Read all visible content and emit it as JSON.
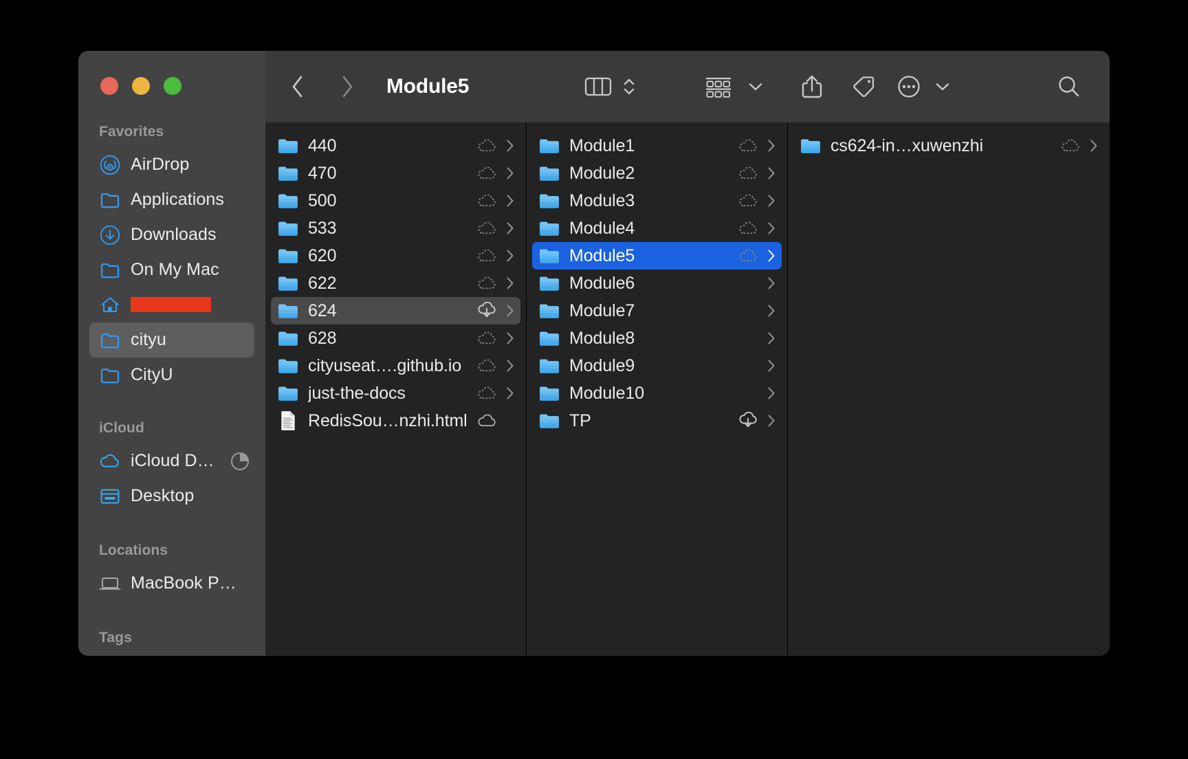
{
  "window": {
    "traffic_lights": [
      "close",
      "minimize",
      "maximize"
    ],
    "colors": {
      "sidebar_bg": "#434343",
      "toolbar_bg": "#3a3a3a",
      "content_bg": "#232323",
      "accent_blue": "#1a62e0",
      "folder_blue": "#54b4ef",
      "icon_blue": "#2196f3",
      "redaction_red": "#e8371b",
      "selected_gray": "#4a4a4a"
    }
  },
  "toolbar": {
    "back_label": "Back",
    "forward_label": "Forward",
    "title": "Module5",
    "view_label": "Column View",
    "view_chevron_label": "View Options",
    "arrange_label": "Group Items",
    "arrange_chevron_label": "Group Options",
    "share_label": "Share",
    "tag_label": "Tags",
    "more_label": "More",
    "more_chevron_label": "More Options",
    "search_label": "Search"
  },
  "sidebar": {
    "sections": [
      {
        "id": "favorites",
        "header": "Favorites"
      },
      {
        "id": "icloud",
        "header": "iCloud"
      },
      {
        "id": "locations",
        "header": "Locations"
      },
      {
        "id": "tags",
        "header": "Tags"
      }
    ],
    "favorites": [
      {
        "label": "AirDrop",
        "icon": "airdrop-icon",
        "selected": false,
        "redacted": false
      },
      {
        "label": "Applications",
        "icon": "folder-icon",
        "selected": false,
        "redacted": false
      },
      {
        "label": "Downloads",
        "icon": "downloads-icon",
        "selected": false,
        "redacted": false
      },
      {
        "label": "On My Mac",
        "icon": "folder-icon",
        "selected": false,
        "redacted": false
      },
      {
        "label": "",
        "icon": "home-icon",
        "selected": false,
        "redacted": true
      },
      {
        "label": "cityu",
        "icon": "folder-icon",
        "selected": true,
        "redacted": false
      },
      {
        "label": "CityU",
        "icon": "folder-icon",
        "selected": false,
        "redacted": false
      }
    ],
    "icloud": [
      {
        "label": "iCloud D…",
        "icon": "icloud-icon",
        "selected": false,
        "progress": true
      },
      {
        "label": "Desktop",
        "icon": "desktop-icon",
        "selected": false,
        "progress": false
      }
    ],
    "locations": [
      {
        "label": "MacBook P…",
        "icon": "laptop-icon",
        "selected": false
      }
    ],
    "tags_header_partial": "Tags"
  },
  "columns": [
    {
      "id": "column-1",
      "items": [
        {
          "name": "440",
          "type": "folder",
          "cloud": "dashed",
          "chevron": true,
          "selected": false
        },
        {
          "name": "470",
          "type": "folder",
          "cloud": "dashed",
          "chevron": true,
          "selected": false
        },
        {
          "name": "500",
          "type": "folder",
          "cloud": "dashed",
          "chevron": true,
          "selected": false
        },
        {
          "name": "533",
          "type": "folder",
          "cloud": "dashed",
          "chevron": true,
          "selected": false
        },
        {
          "name": "620",
          "type": "folder",
          "cloud": "dashed",
          "chevron": true,
          "selected": false
        },
        {
          "name": "622",
          "type": "folder",
          "cloud": "dashed",
          "chevron": true,
          "selected": false
        },
        {
          "name": "624",
          "type": "folder",
          "cloud": "download",
          "chevron": true,
          "selected": "gray"
        },
        {
          "name": "628",
          "type": "folder",
          "cloud": "dashed",
          "chevron": true,
          "selected": false
        },
        {
          "name": "cityuseat….github.io",
          "type": "folder",
          "cloud": "dashed",
          "chevron": true,
          "selected": false
        },
        {
          "name": "just-the-docs",
          "type": "folder",
          "cloud": "dashed",
          "chevron": true,
          "selected": false
        },
        {
          "name": "RedisSou…nzhi.html",
          "type": "html-file",
          "cloud": "solid",
          "chevron": false,
          "selected": false
        }
      ]
    },
    {
      "id": "column-2",
      "items": [
        {
          "name": "Module1",
          "type": "folder",
          "cloud": "dashed",
          "chevron": true,
          "selected": false
        },
        {
          "name": "Module2",
          "type": "folder",
          "cloud": "dashed",
          "chevron": true,
          "selected": false
        },
        {
          "name": "Module3",
          "type": "folder",
          "cloud": "dashed",
          "chevron": true,
          "selected": false
        },
        {
          "name": "Module4",
          "type": "folder",
          "cloud": "dashed",
          "chevron": true,
          "selected": false
        },
        {
          "name": "Module5",
          "type": "folder",
          "cloud": "dashed",
          "chevron": true,
          "selected": "blue"
        },
        {
          "name": "Module6",
          "type": "folder",
          "cloud": "none",
          "chevron": true,
          "selected": false
        },
        {
          "name": "Module7",
          "type": "folder",
          "cloud": "none",
          "chevron": true,
          "selected": false
        },
        {
          "name": "Module8",
          "type": "folder",
          "cloud": "none",
          "chevron": true,
          "selected": false
        },
        {
          "name": "Module9",
          "type": "folder",
          "cloud": "none",
          "chevron": true,
          "selected": false
        },
        {
          "name": "Module10",
          "type": "folder",
          "cloud": "none",
          "chevron": true,
          "selected": false
        },
        {
          "name": "TP",
          "type": "folder",
          "cloud": "download",
          "chevron": true,
          "selected": false
        }
      ]
    },
    {
      "id": "column-3",
      "items": [
        {
          "name": "cs624-in…xuwenzhi",
          "type": "folder",
          "cloud": "dashed",
          "chevron": true,
          "selected": false
        }
      ]
    }
  ]
}
